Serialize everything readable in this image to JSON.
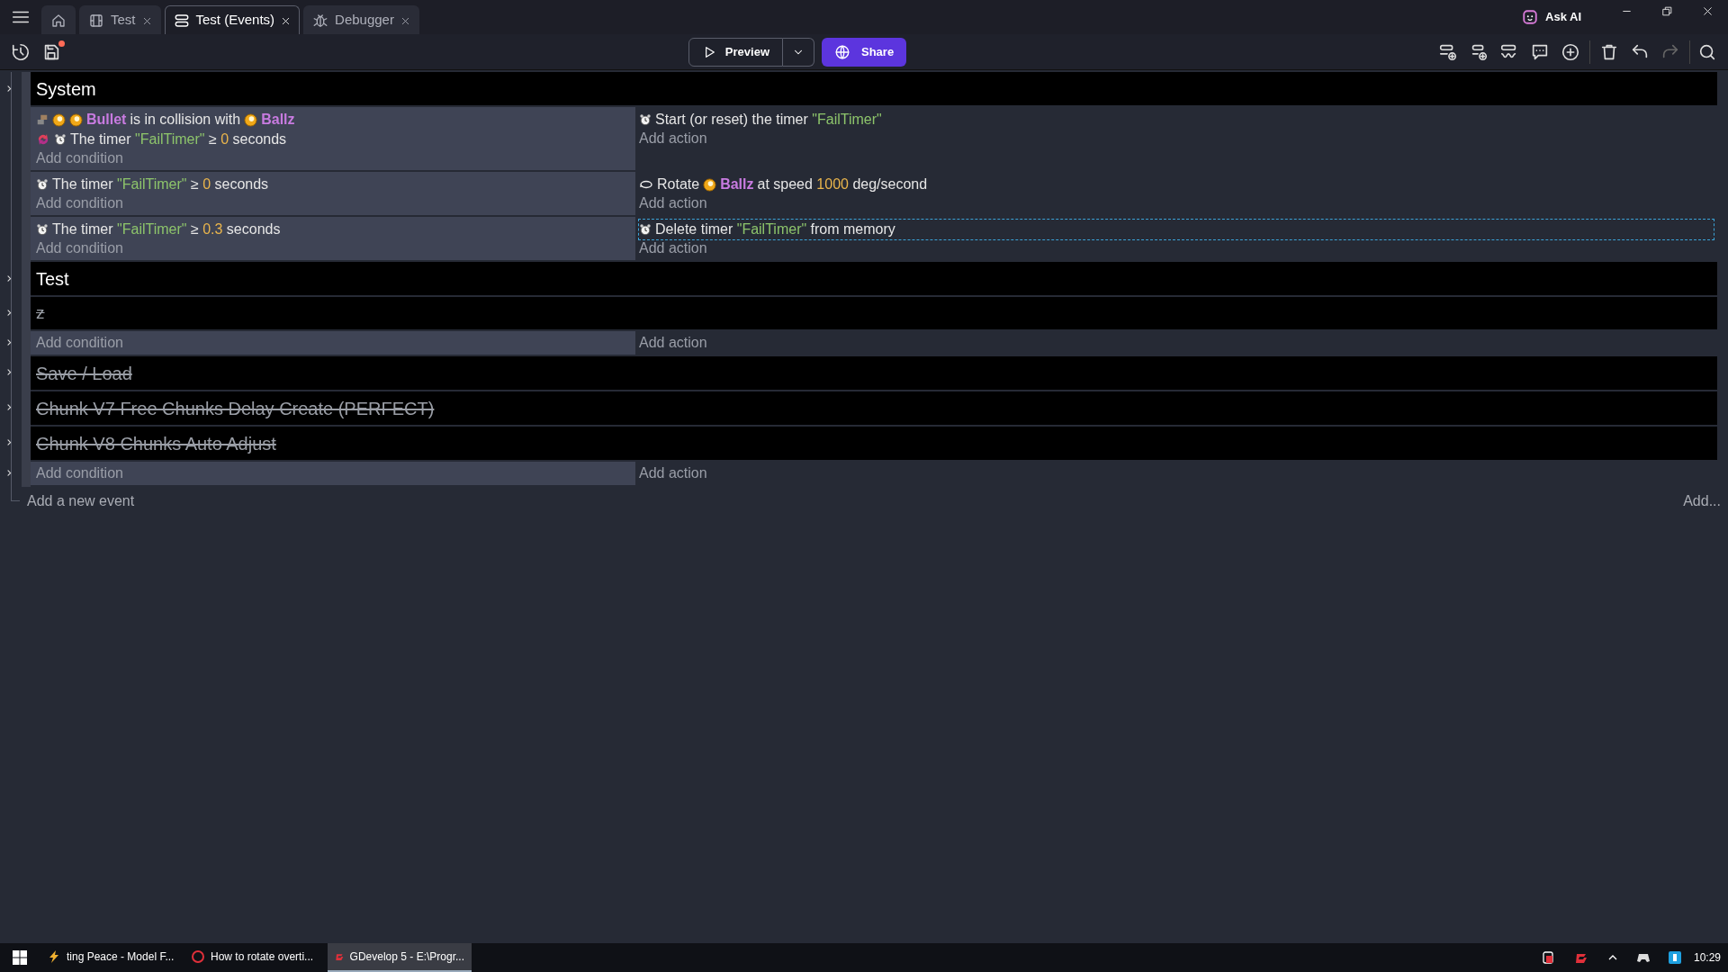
{
  "tabs": [
    {
      "kind": "home",
      "selected": false
    },
    {
      "kind": "scene",
      "label": "Test",
      "selected": false
    },
    {
      "kind": "events",
      "label": "Test (Events)",
      "selected": true
    },
    {
      "kind": "debugger",
      "label": "Debugger",
      "selected": false
    }
  ],
  "ask_ai": "Ask AI",
  "preview": "Preview",
  "share": "Share",
  "unsaved": true,
  "events": [
    {
      "kind": "group",
      "title": "System",
      "disabled": false
    },
    {
      "kind": "event",
      "conditions": [
        {
          "kind": "collision",
          "parts": [
            {
              "kind": "object",
              "text": "Bullet"
            },
            {
              "kind": "text",
              "text": "is in collision with"
            },
            {
              "kind": "object",
              "text": "Ballz"
            }
          ]
        },
        {
          "kind": "timer_repeat",
          "parts": [
            {
              "kind": "text",
              "text": "The timer"
            },
            {
              "kind": "string",
              "text": "\"FailTimer\""
            },
            {
              "kind": "text",
              "text": "≥"
            },
            {
              "kind": "number",
              "text": "0"
            },
            {
              "kind": "text",
              "text": "seconds"
            }
          ]
        }
      ],
      "add_condition": "Add condition",
      "actions": [
        {
          "kind": "timer",
          "selected": false,
          "parts": [
            {
              "kind": "text",
              "text": "Start (or reset) the timer"
            },
            {
              "kind": "string",
              "text": "\"FailTimer\""
            }
          ]
        }
      ],
      "add_action": "Add action"
    },
    {
      "kind": "event",
      "conditions": [
        {
          "kind": "timer",
          "parts": [
            {
              "kind": "text",
              "text": "The timer"
            },
            {
              "kind": "string",
              "text": "\"FailTimer\""
            },
            {
              "kind": "text",
              "text": "≥"
            },
            {
              "kind": "number",
              "text": "0"
            },
            {
              "kind": "text",
              "text": "seconds"
            }
          ]
        }
      ],
      "add_condition": "Add condition",
      "actions": [
        {
          "kind": "rotate",
          "selected": false,
          "parts": [
            {
              "kind": "text",
              "text": "Rotate"
            },
            {
              "kind": "object",
              "text": "Ballz"
            },
            {
              "kind": "text",
              "text": "at speed"
            },
            {
              "kind": "number",
              "text": "1000"
            },
            {
              "kind": "text",
              "text": "deg/second"
            }
          ]
        }
      ],
      "add_action": "Add action"
    },
    {
      "kind": "event",
      "conditions": [
        {
          "kind": "timer",
          "parts": [
            {
              "kind": "text",
              "text": "The timer"
            },
            {
              "kind": "string",
              "text": "\"FailTimer\""
            },
            {
              "kind": "text",
              "text": "≥"
            },
            {
              "kind": "number",
              "text": "0.3"
            },
            {
              "kind": "text",
              "text": "seconds"
            }
          ]
        }
      ],
      "add_condition": "Add condition",
      "actions": [
        {
          "kind": "timer",
          "selected": true,
          "parts": [
            {
              "kind": "text",
              "text": "Delete timer"
            },
            {
              "kind": "string",
              "text": "\"FailTimer\""
            },
            {
              "kind": "text",
              "text": "from memory"
            }
          ]
        }
      ],
      "add_action": "Add action"
    },
    {
      "kind": "group",
      "title": "Test",
      "disabled": false
    },
    {
      "kind": "group",
      "title": "z",
      "disabled": true
    },
    {
      "kind": "event",
      "add_condition": "Add condition",
      "add_action": "Add action"
    },
    {
      "kind": "group",
      "title": "Save / Load",
      "disabled": true
    },
    {
      "kind": "group",
      "title": "Chunk V7 Free Chunks Delay Create (PERFECT)",
      "disabled": true
    },
    {
      "kind": "group",
      "title": "Chunk V8 Chunks Auto Adjust",
      "disabled": true
    },
    {
      "kind": "event",
      "add_condition": "Add condition",
      "add_action": "Add action"
    }
  ],
  "add_event": "Add a new event",
  "add_more": "Add...",
  "taskbar": {
    "tasks": [
      {
        "kind": "bolt",
        "label": "ting Peace - Model F...",
        "selected": false
      },
      {
        "kind": "browser",
        "label": "How to rotate overti...",
        "selected": false
      },
      {
        "kind": "gdevelop",
        "label": "GDevelop 5 - E:\\Progr...",
        "selected": true
      }
    ],
    "clock": "10:29"
  }
}
